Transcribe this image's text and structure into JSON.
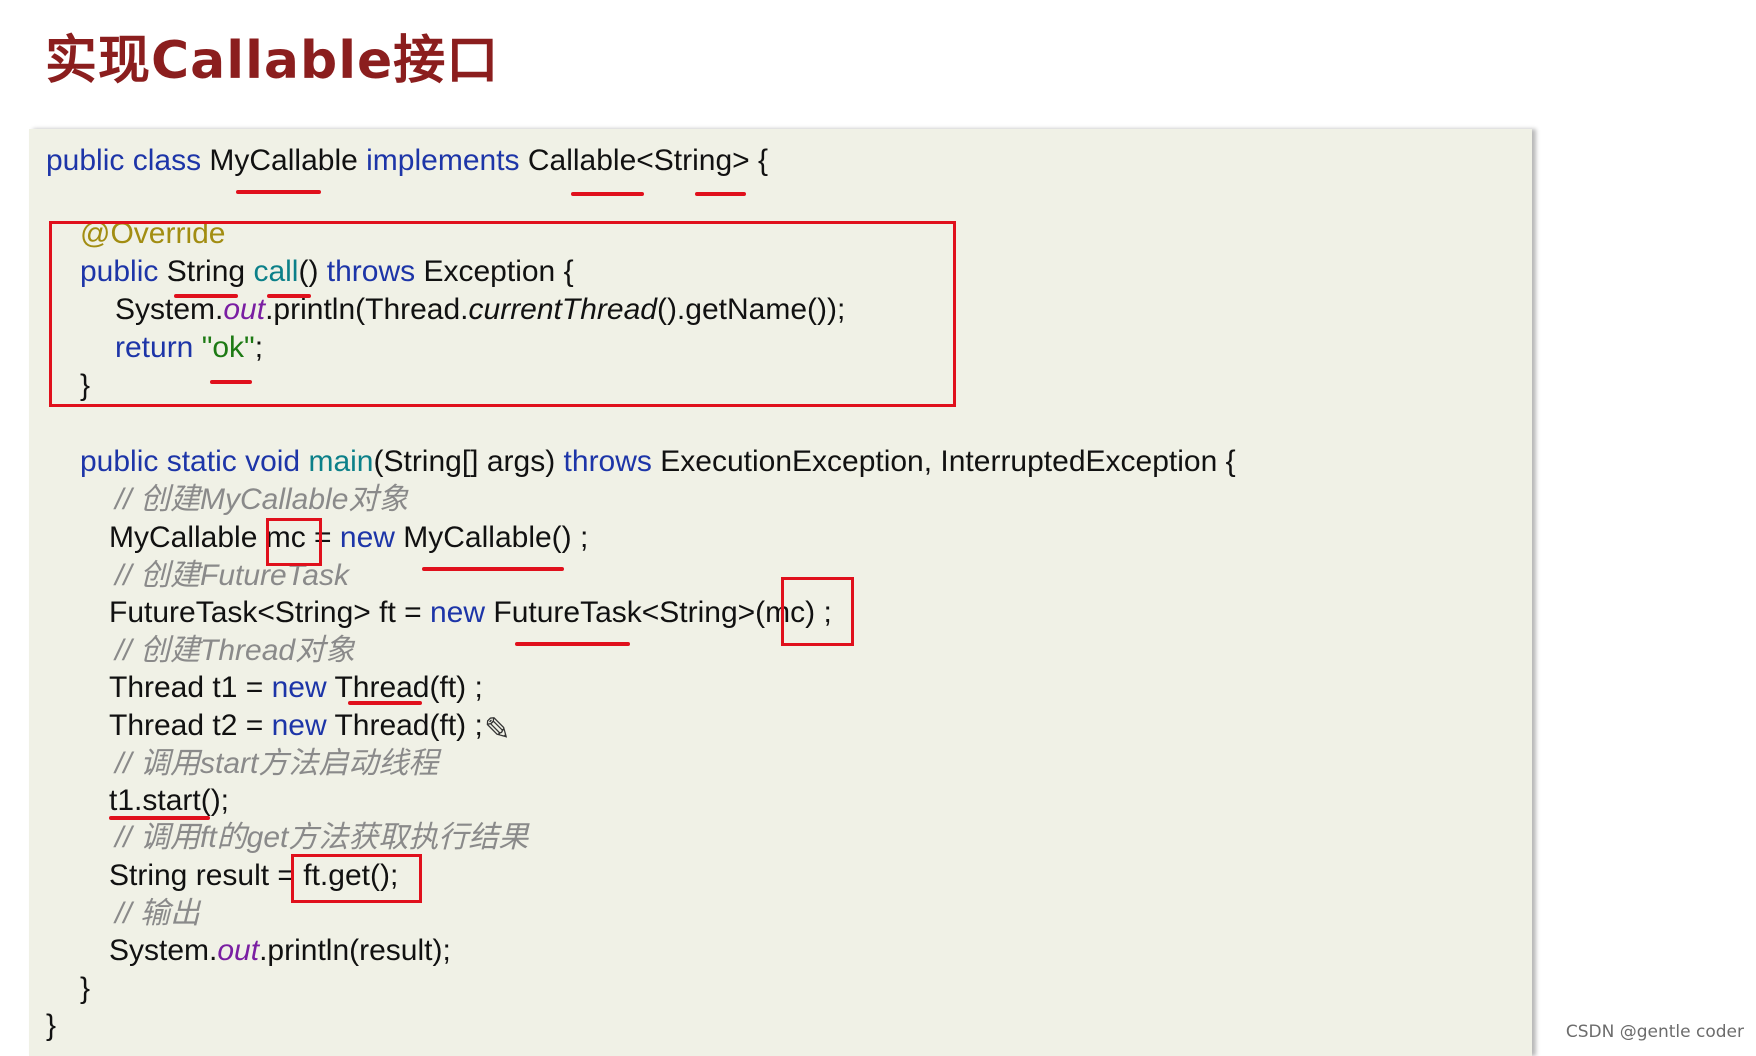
{
  "title": "实现Callable接口",
  "code": {
    "l1": {
      "a": "public class ",
      "b": "MyCallable ",
      "c": "implements ",
      "d": "Callable<String> {"
    },
    "l2": {
      "a": "@Override"
    },
    "l3": {
      "a": "public ",
      "b": "String ",
      "c": "call",
      "d": "() ",
      "e": "throws ",
      "f": "Exception {"
    },
    "l4": {
      "a": "System.",
      "b": "out",
      "c": ".println(Thread.",
      "d": "currentThread",
      "e": "().getName());"
    },
    "l5": {
      "a": "return ",
      "b": "\"ok\"",
      "c": ";"
    },
    "l6": {
      "a": "}"
    },
    "l7": {
      "a": "public static void ",
      "b": "main",
      "c": "(String[] args) ",
      "d": "throws ",
      "e": "ExecutionException, InterruptedException {"
    },
    "l8": {
      "a": "// 创建MyCallable对象"
    },
    "l9": {
      "a": "MyCallable mc = ",
      "b": "new ",
      "c": "MyCallable() ;"
    },
    "l10": {
      "a": "// 创建FutureTask"
    },
    "l11": {
      "a": "FutureTask<String> ft = ",
      "b": "new ",
      "c": "FutureTask<String>(mc) ;"
    },
    "l12": {
      "a": "// 创建Thread对象"
    },
    "l13": {
      "a": "Thread t1 = ",
      "b": "new ",
      "c": "Thread(ft) ;"
    },
    "l14": {
      "a": "Thread t2 = ",
      "b": "new ",
      "c": "Thread(ft) ;"
    },
    "l15": {
      "a": "// 调用start方法启动线程"
    },
    "l16": {
      "a": "t1.start();"
    },
    "l17": {
      "a": "// 调用ft的get方法获取执行结果"
    },
    "l18": {
      "a": "String result = ft.get();"
    },
    "l19": {
      "a": "// 输出"
    },
    "l20": {
      "a": "System.",
      "b": "out",
      "c": ".println(result);"
    },
    "l21": {
      "a": "}"
    },
    "l22": {
      "a": "}"
    }
  },
  "watermark": "CSDN @gentle coder",
  "colors": {
    "title": "#8b1e1e",
    "keyword": "#1d35a8",
    "method": "#0c8089",
    "annotation": "#a28d12",
    "string": "#1d7a14",
    "field": "#7a1fa2",
    "comment": "#8a8a8a",
    "highlight": "#e0101c",
    "panel": "#f0f1e6"
  },
  "icons": [
    "pencil-cursor-icon"
  ]
}
